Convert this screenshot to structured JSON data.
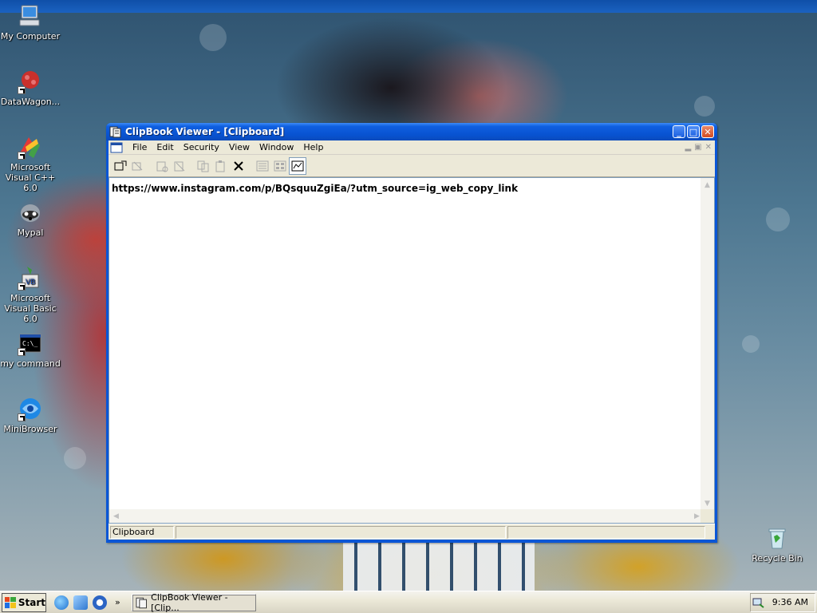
{
  "desktop": {
    "icons": [
      {
        "label": "My Computer",
        "icon": "my-computer-icon"
      },
      {
        "label": "DataWagon...",
        "icon": "datawagon-icon"
      },
      {
        "label": "Microsoft Visual C++ 6.0",
        "icon": "visual-cpp-icon"
      },
      {
        "label": "Mypal",
        "icon": "mypal-icon"
      },
      {
        "label": "Microsoft Visual Basic 6.0",
        "icon": "visual-basic-icon"
      },
      {
        "label": "my command",
        "icon": "command-prompt-icon"
      },
      {
        "label": "MiniBrowser",
        "icon": "minibrowser-icon"
      },
      {
        "label": "Recycle Bin",
        "icon": "recycle-bin-icon"
      }
    ]
  },
  "window": {
    "title": "ClipBook Viewer - [Clipboard]",
    "menu": [
      "File",
      "Edit",
      "Security",
      "View",
      "Window",
      "Help"
    ],
    "content_text": "https://www.instagram.com/p/BQsquuZgiEa/?utm_source=ig_web_copy_link",
    "status_text": "Clipboard",
    "toolbar_icons": [
      "connect-icon",
      "disconnect-icon",
      "share-icon",
      "stop-sharing-icon",
      "copy-icon",
      "paste-icon",
      "delete-icon",
      "table-of-contents-icon",
      "thumbnails-icon",
      "full-page-icon"
    ],
    "title_buttons": {
      "minimize": "_",
      "maximize": "□",
      "close": "✕"
    }
  },
  "taskbar": {
    "start_label": "Start",
    "chevron": "»",
    "task_button_label": "ClipBook Viewer - [Clip...",
    "clock": "9:36 AM"
  },
  "colors": {
    "title_blue": "#0a56d6",
    "taskbar": "#ece9d8",
    "menu_bg": "#ece9d8"
  }
}
